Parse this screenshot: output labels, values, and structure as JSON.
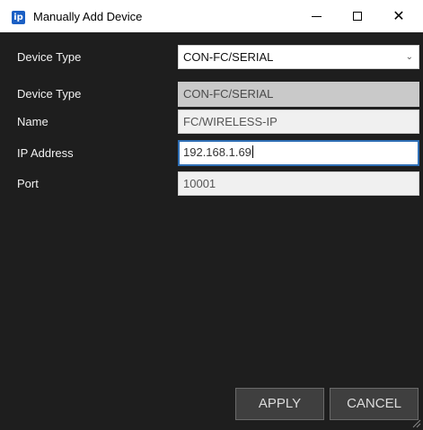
{
  "window": {
    "title": "Manually Add Device",
    "icon_text": "ip",
    "icon_color": "#1b5fc4"
  },
  "form": {
    "device_type_select": {
      "label": "Device Type",
      "value": "CON-FC/SERIAL"
    },
    "device_type": {
      "label": "Device Type",
      "value": "CON-FC/SERIAL"
    },
    "name": {
      "label": "Name",
      "value": "FC/WIRELESS-IP"
    },
    "ip_address": {
      "label": "IP Address",
      "value": "192.168.1.69"
    },
    "port": {
      "label": "Port",
      "value": "10001"
    }
  },
  "buttons": {
    "apply": "APPLY",
    "cancel": "CANCEL"
  },
  "colors": {
    "background": "#1e1e1e",
    "focus_border": "#2f6fb5",
    "button_bg": "#3f3f3f"
  }
}
